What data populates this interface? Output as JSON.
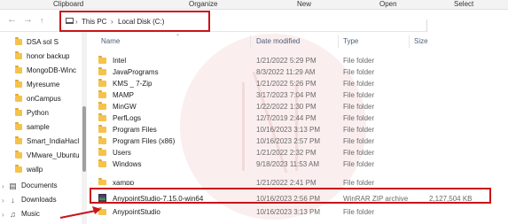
{
  "ribbon": {
    "groups": [
      "Clipboard",
      "Organize",
      "New",
      "Open",
      "Select"
    ]
  },
  "address": {
    "crumbs": [
      "This PC",
      "Local Disk (C:)"
    ],
    "back_icon": "arrow-left-icon",
    "forward_icon": "arrow-right-icon",
    "up_icon": "arrow-up-icon"
  },
  "sidebar": {
    "items": [
      {
        "label": "DSA sol S",
        "icon": "folder-icon"
      },
      {
        "label": "honor backup",
        "icon": "folder-icon"
      },
      {
        "label": "MongoDB-Winc",
        "icon": "folder-icon"
      },
      {
        "label": "Myresume",
        "icon": "folder-icon"
      },
      {
        "label": "onCampus",
        "icon": "folder-icon"
      },
      {
        "label": "Python",
        "icon": "folder-icon"
      },
      {
        "label": "sample",
        "icon": "folder-icon"
      },
      {
        "label": "Smart_IndiaHacl",
        "icon": "folder-icon"
      },
      {
        "label": "VMware_Ubuntu",
        "icon": "folder-icon"
      },
      {
        "label": "wallp",
        "icon": "folder-icon"
      }
    ],
    "libraries": [
      {
        "label": "Documents",
        "icon": "document-icon"
      },
      {
        "label": "Downloads",
        "icon": "download-icon"
      },
      {
        "label": "Music",
        "icon": "music-icon"
      }
    ]
  },
  "columns": {
    "name": "Name",
    "date": "Date modified",
    "type": "Type",
    "size": "Size"
  },
  "files": [
    {
      "name": "Intel",
      "date": "1/21/2022 5:29 PM",
      "type": "File folder",
      "size": ""
    },
    {
      "name": "JavaPrograms",
      "date": "8/3/2022 11:29 AM",
      "type": "File folder",
      "size": ""
    },
    {
      "name": "KMS _ 7-Zip",
      "date": "1/21/2022 5:26 PM",
      "type": "File folder",
      "size": ""
    },
    {
      "name": "MAMP",
      "date": "3/17/2023 7:04 PM",
      "type": "File folder",
      "size": ""
    },
    {
      "name": "MinGW",
      "date": "1/22/2022 1:30 PM",
      "type": "File folder",
      "size": ""
    },
    {
      "name": "PerfLogs",
      "date": "12/7/2019 2:44 PM",
      "type": "File folder",
      "size": ""
    },
    {
      "name": "Program Files",
      "date": "10/16/2023 3:13 PM",
      "type": "File folder",
      "size": ""
    },
    {
      "name": "Program Files (x86)",
      "date": "10/16/2023 2:57 PM",
      "type": "File folder",
      "size": ""
    },
    {
      "name": "Users",
      "date": "1/21/2022 2:32 PM",
      "type": "File folder",
      "size": ""
    },
    {
      "name": "Windows",
      "date": "9/18/2023 11:53 AM",
      "type": "File folder",
      "size": ""
    },
    {
      "name": "xampp",
      "date": "1/21/2022 2:41 PM",
      "type": "File folder",
      "size": ""
    },
    {
      "name": "AnypointStudio-7.15.0-win64",
      "date": "10/16/2023 2:56 PM",
      "type": "WinRAR ZIP archive",
      "size": "2,127,504 KB"
    },
    {
      "name": "AnypointStudio",
      "date": "10/16/2023 3:13 PM",
      "type": "File folder",
      "size": ""
    }
  ],
  "colors": {
    "highlight": "#c8141a",
    "folder": "#f5c24b",
    "watermark": "#fbeeee"
  }
}
